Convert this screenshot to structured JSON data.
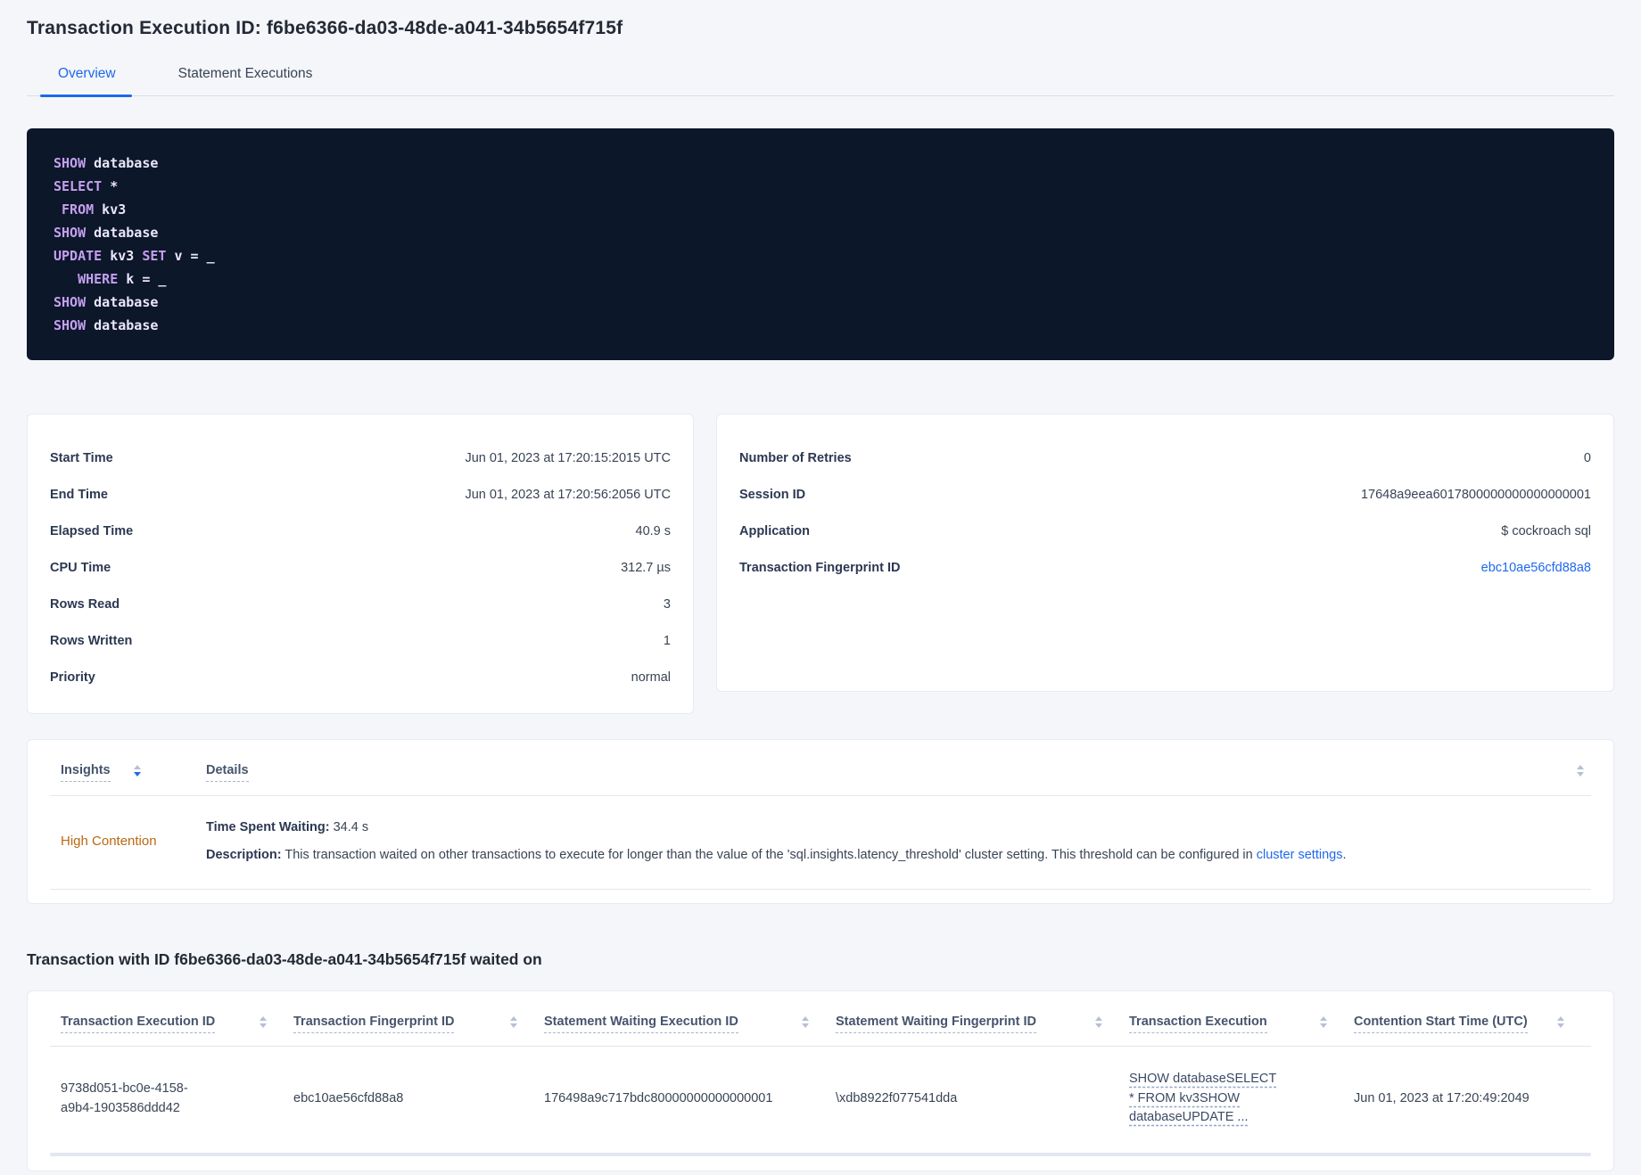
{
  "header": {
    "title": "Transaction Execution ID: f6be6366-da03-48de-a041-34b5654f715f",
    "tabs": [
      {
        "label": "Overview",
        "active": true
      },
      {
        "label": "Statement Executions",
        "active": false
      }
    ]
  },
  "sql_block": {
    "lines": [
      [
        [
          "kw",
          "SHOW"
        ],
        [
          "tx",
          " database"
        ]
      ],
      [
        [
          "kw",
          "SELECT"
        ],
        [
          "tx",
          " *"
        ]
      ],
      [
        [
          "tx",
          " "
        ],
        [
          "kw",
          "FROM"
        ],
        [
          "tx",
          " kv3"
        ]
      ],
      [
        [
          "kw",
          "SHOW"
        ],
        [
          "tx",
          " database"
        ]
      ],
      [
        [
          "kw",
          "UPDATE"
        ],
        [
          "tx",
          " kv3 "
        ],
        [
          "kw",
          "SET"
        ],
        [
          "tx",
          " v = _"
        ]
      ],
      [
        [
          "tx",
          "   "
        ],
        [
          "kw",
          "WHERE"
        ],
        [
          "tx",
          " k = _"
        ]
      ],
      [
        [
          "kw",
          "SHOW"
        ],
        [
          "tx",
          " database"
        ]
      ],
      [
        [
          "kw",
          "SHOW"
        ],
        [
          "tx",
          " database"
        ]
      ]
    ]
  },
  "details": {
    "left": [
      {
        "label": "Start Time",
        "value": "Jun 01, 2023 at 17:20:15:2015 UTC"
      },
      {
        "label": "End Time",
        "value": "Jun 01, 2023 at 17:20:56:2056 UTC"
      },
      {
        "label": "Elapsed Time",
        "value": "40.9 s"
      },
      {
        "label": "CPU Time",
        "value": "312.7 µs"
      },
      {
        "label": "Rows Read",
        "value": "3"
      },
      {
        "label": "Rows Written",
        "value": "1"
      },
      {
        "label": "Priority",
        "value": "normal"
      }
    ],
    "right": [
      {
        "label": "Number of Retries",
        "value": "0"
      },
      {
        "label": "Session ID",
        "value": "17648a9eea6017800000000000000001"
      },
      {
        "label": "Application",
        "value": "$ cockroach sql"
      },
      {
        "label": "Transaction Fingerprint ID",
        "value": "ebc10ae56cfd88a8",
        "link": true
      }
    ]
  },
  "insights": {
    "columns": {
      "insights_label": "Insights",
      "details_label": "Details"
    },
    "rows": [
      {
        "insight": "High Contention",
        "waiting_label": "Time Spent Waiting:",
        "waiting_value": " 34.4 s",
        "description_label": "Description:",
        "description_text": " This transaction waited on other transactions to execute for longer than the value of the 'sql.insights.latency_threshold' cluster setting. This threshold can be configured in ",
        "description_link": "cluster settings",
        "description_suffix": "."
      }
    ]
  },
  "waited_on": {
    "heading": "Transaction with ID f6be6366-da03-48de-a041-34b5654f715f waited on",
    "columns": [
      "Transaction Execution ID",
      "Transaction Fingerprint ID",
      "Statement Waiting Execution ID",
      "Statement Waiting Fingerprint ID",
      "Transaction Execution",
      "Contention Start Time (UTC)"
    ],
    "rows": [
      {
        "transaction_execution_id": "9738d051-bc0e-4158-a9b4-1903586ddd42",
        "transaction_fingerprint_id": "ebc10ae56cfd88a8",
        "statement_waiting_execution_id": "176498a9c717bdc80000000000000001",
        "statement_waiting_fingerprint_id": "\\xdb8922f077541dda",
        "transaction_execution": "SHOW databaseSELECT * FROM kv3SHOW databaseUPDATE ...",
        "contention_start_time": "Jun 01, 2023 at 17:20:49:2049"
      }
    ]
  },
  "colors": {
    "accent_blue": "#1e69eb",
    "insight_orange": "#ba6811",
    "code_background": "#0c1729",
    "code_keyword": "#c59ff0"
  }
}
